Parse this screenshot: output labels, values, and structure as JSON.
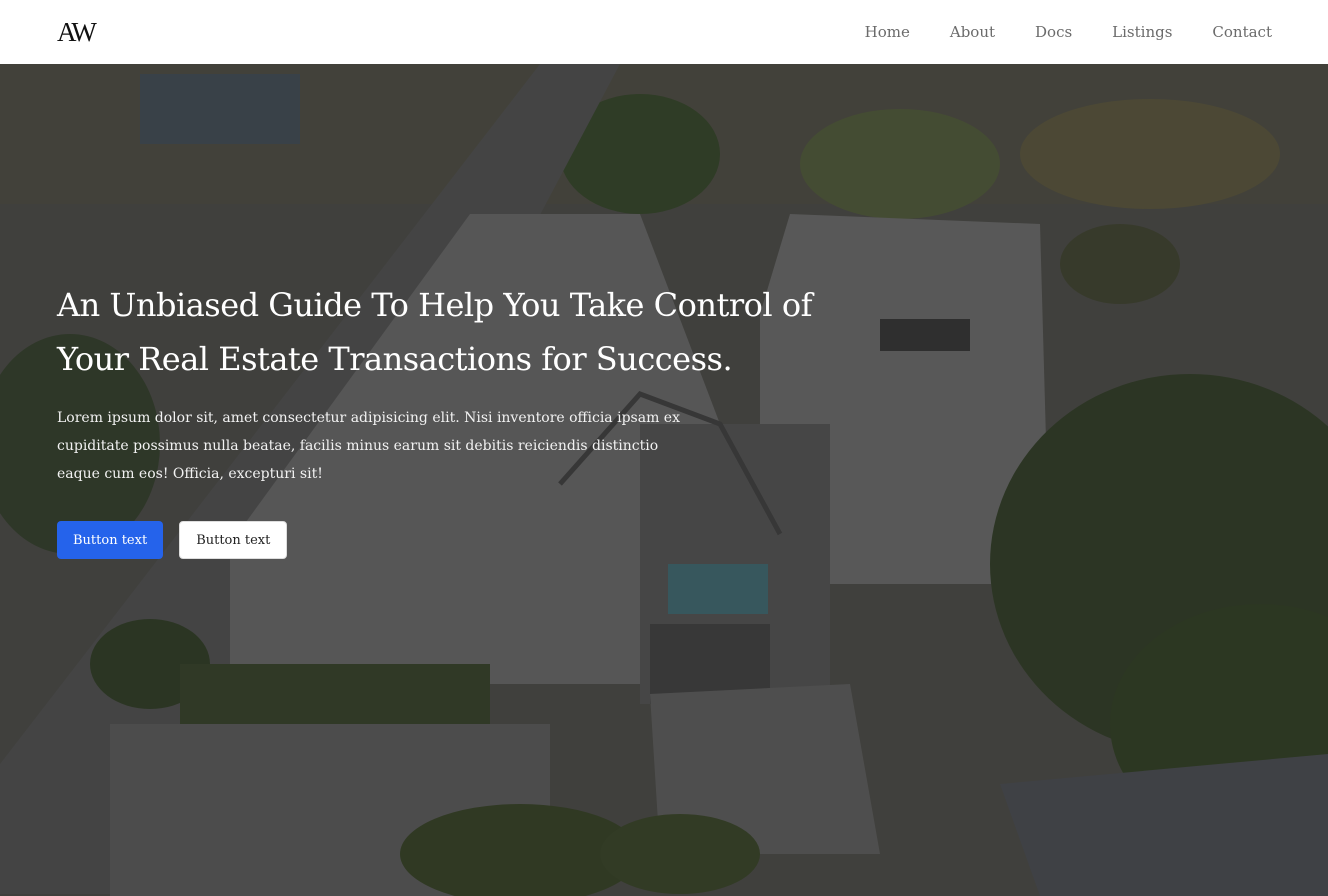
{
  "brand": {
    "logo": "AW"
  },
  "nav": {
    "items": [
      {
        "label": "Home"
      },
      {
        "label": "About"
      },
      {
        "label": "Docs"
      },
      {
        "label": "Listings"
      },
      {
        "label": "Contact"
      }
    ]
  },
  "hero": {
    "title": "An Unbiased Guide To Help You Take Control of Your Real Estate Transactions for Success.",
    "text": "Lorem ipsum dolor sit, amet consectetur adipisicing elit. Nisi inventore officia ipsam ex cupiditate possimus nulla beatae, facilis minus earum sit debitis reiciendis distinctio eaque cum eos! Officia, excepturi sit!",
    "primary_button": "Button text",
    "secondary_button": "Button text"
  },
  "colors": {
    "primary": "#2563eb",
    "nav_text": "#6b6b6b"
  }
}
